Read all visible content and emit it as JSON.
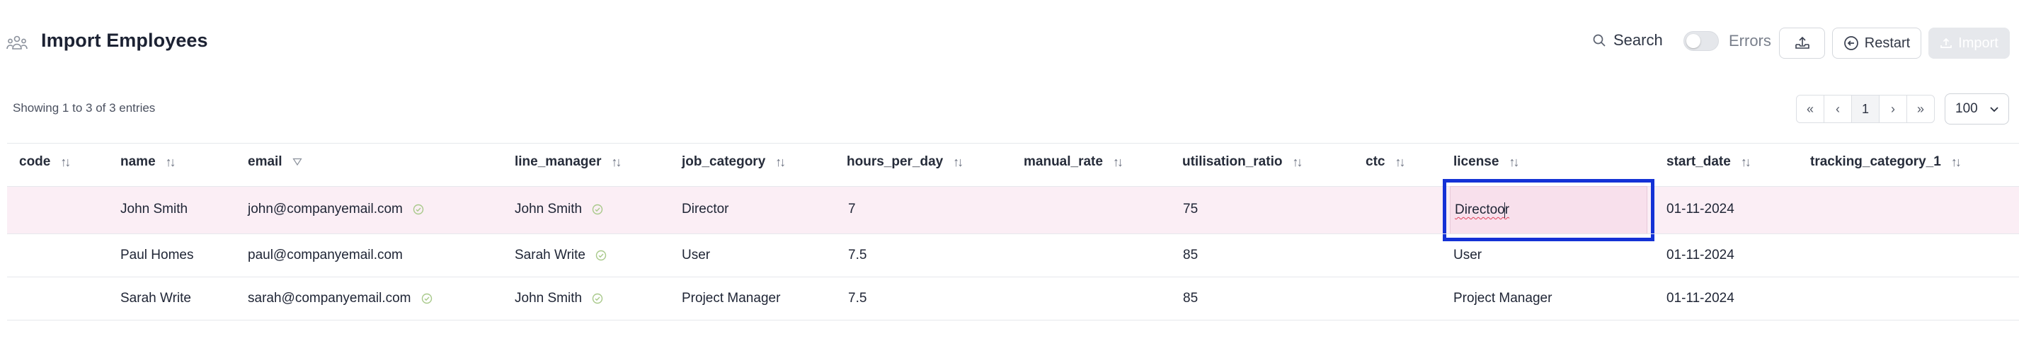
{
  "header": {
    "title": "Import Employees",
    "search_label": "Search",
    "errors_label": "Errors",
    "errors_toggle_on": false,
    "restart_label": "Restart",
    "import_label": "Import"
  },
  "summary": {
    "showing_text": "Showing 1 to 3 of 3 entries"
  },
  "pagination": {
    "first": "«",
    "prev": "‹",
    "current_page": "1",
    "next": "›",
    "last": "»",
    "page_size": "100"
  },
  "table": {
    "columns": [
      {
        "key": "code",
        "label": "code"
      },
      {
        "key": "name",
        "label": "name"
      },
      {
        "key": "email",
        "label": "email"
      },
      {
        "key": "line_manager",
        "label": "line_manager"
      },
      {
        "key": "job_category",
        "label": "job_category"
      },
      {
        "key": "hours_per_day",
        "label": "hours_per_day"
      },
      {
        "key": "manual_rate",
        "label": "manual_rate"
      },
      {
        "key": "utilisation_ratio",
        "label": "utilisation_ratio"
      },
      {
        "key": "ctc",
        "label": "ctc"
      },
      {
        "key": "license",
        "label": "license"
      },
      {
        "key": "start_date",
        "label": "start_date"
      },
      {
        "key": "tracking_category_1",
        "label": "tracking_category_1"
      }
    ],
    "rows": [
      {
        "code": "",
        "name": "John Smith",
        "email": "john@companyemail.com",
        "line_manager": "John Smith",
        "job_category": "Director",
        "hours_per_day": "7",
        "manual_rate": "",
        "utilisation_ratio": "75",
        "ctc": "",
        "license": "Directoor",
        "start_date": "01-11-2024",
        "tracking_category_1": ""
      },
      {
        "code": "",
        "name": "Paul Homes",
        "email": "paul@companyemail.com",
        "line_manager": "Sarah Write",
        "job_category": "User",
        "hours_per_day": "7.5",
        "manual_rate": "",
        "utilisation_ratio": "85",
        "ctc": "",
        "license": "User",
        "start_date": "01-11-2024",
        "tracking_category_1": ""
      },
      {
        "code": "",
        "name": "Sarah Write",
        "email": "sarah@companyemail.com",
        "line_manager": "John Smith",
        "job_category": "Project Manager",
        "hours_per_day": "7.5",
        "manual_rate": "",
        "utilisation_ratio": "85",
        "ctc": "",
        "license": "Project Manager",
        "start_date": "01-11-2024",
        "tracking_category_1": ""
      }
    ],
    "sort_glyph": "↑↓"
  },
  "icons": {
    "page": "people-group-icon",
    "search": "search-icon",
    "upload": "upload-tray-icon",
    "restart": "restart-arrow-icon",
    "import": "import-upload-icon",
    "email_filter": "filter-funnel-icon",
    "verified": "check-circle-icon"
  },
  "colors": {
    "selected_row": "#fbeef5",
    "edit_focus_border": "#1432d6",
    "edit_cell_bg": "#f8e0ec",
    "valid_check": "#a8c98a",
    "import_disabled": "#e6e8ec"
  }
}
